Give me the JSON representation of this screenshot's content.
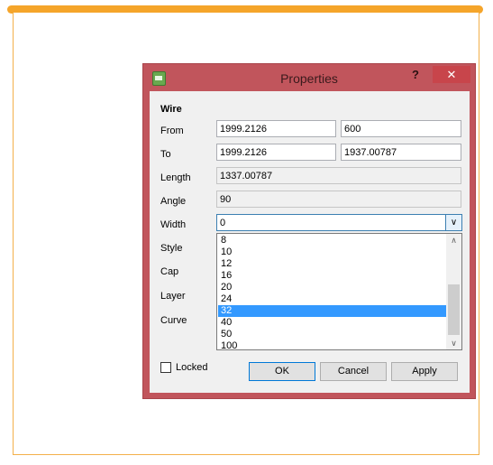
{
  "window": {
    "title": "Properties",
    "help": "?",
    "close": "✕"
  },
  "section": "Wire",
  "labels": {
    "from": "From",
    "to": "To",
    "length": "Length",
    "angle": "Angle",
    "width": "Width",
    "style": "Style",
    "cap": "Cap",
    "layer": "Layer",
    "curve": "Curve"
  },
  "fields": {
    "from_x": "1999.2126",
    "from_y": "600",
    "to_x": "1999.2126",
    "to_y": "1937.00787",
    "length": "1337.00787",
    "angle": "90",
    "width": "0"
  },
  "width_options": [
    "8",
    "10",
    "12",
    "16",
    "20",
    "24",
    "32",
    "40",
    "50",
    "100"
  ],
  "width_highlighted": "32",
  "locked": {
    "label": "Locked",
    "checked": false
  },
  "buttons": {
    "ok": "OK",
    "cancel": "Cancel",
    "apply": "Apply"
  },
  "icons": {
    "combo_arrow": "chevron-down-icon",
    "scroll_up": "chevron-up-icon",
    "scroll_down": "chevron-down-icon"
  }
}
